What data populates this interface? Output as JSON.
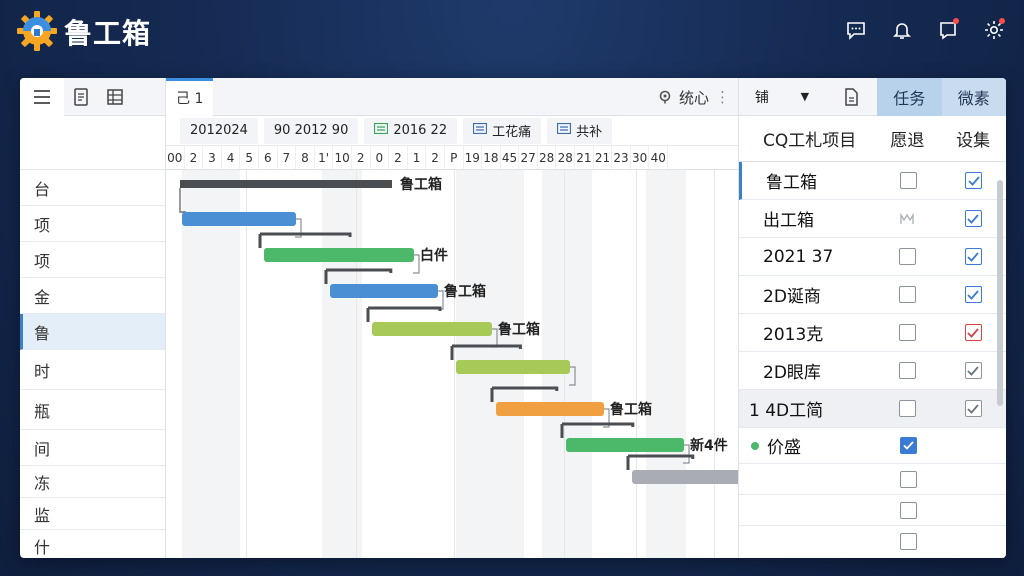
{
  "app": {
    "brand": "鲁工箱"
  },
  "left": {
    "rows": [
      {
        "label": "台",
        "size": ""
      },
      {
        "label": "项",
        "size": ""
      },
      {
        "label": "项",
        "size": ""
      },
      {
        "label": "金",
        "size": ""
      },
      {
        "label": "鲁",
        "size": "active"
      },
      {
        "label": "时",
        "size": "tall"
      },
      {
        "label": "瓶",
        "size": "tall"
      },
      {
        "label": "间",
        "size": ""
      },
      {
        "label": "冻",
        "size": "short"
      },
      {
        "label": "监",
        "size": "short"
      },
      {
        "label": "什",
        "size": "short"
      }
    ]
  },
  "gantt": {
    "tab_label": "己 1",
    "right_label": "统心",
    "periods": [
      {
        "label": "2012024",
        "icon": "none"
      },
      {
        "label": "90  2012 90",
        "icon": "none"
      },
      {
        "label": "2016 22",
        "icon": "green-list-icon"
      },
      {
        "label": "工花痛",
        "icon": "blue-list-icon"
      },
      {
        "label": "共补",
        "icon": "blue-list-icon"
      }
    ],
    "days": [
      "00",
      "2",
      "3",
      "4",
      "5",
      "6",
      "7",
      "8",
      "1'",
      "10",
      "2",
      "0",
      "2",
      "1",
      "2",
      "P",
      "19",
      "18",
      "45",
      "27",
      "28",
      "28",
      "21",
      "21",
      "23",
      "30",
      "40"
    ],
    "bar_labels": [
      "鲁工箱",
      "白件",
      "鲁工箱",
      "鲁工箱",
      "鲁工箱",
      "新4件"
    ]
  },
  "panel": {
    "select_label": "铺",
    "btn_tasks": "任务",
    "btn_search": "微素",
    "headers": {
      "name": "CQ工札项目",
      "col_a": "愿退",
      "col_b": "设集"
    },
    "rows": [
      {
        "name": "鲁工箱",
        "a": "empty",
        "b": "blue-check",
        "style": "hl"
      },
      {
        "name": "出工箱",
        "a": "partial",
        "b": "blue-check",
        "style": ""
      },
      {
        "name": "2021 37",
        "a": "empty",
        "b": "blue-check",
        "style": ""
      },
      {
        "name": "2D诞商",
        "a": "empty",
        "b": "blue-check",
        "style": ""
      },
      {
        "name": "2013克",
        "a": "empty",
        "b": "red-check",
        "style": ""
      },
      {
        "name": "2D眼库",
        "a": "empty",
        "b": "grey-check",
        "style": ""
      },
      {
        "name": "1 4D工简",
        "a": "empty",
        "b": "grey-check",
        "style": "grey"
      }
    ],
    "sub_row": {
      "name": "价盛",
      "a": "filled-check"
    }
  },
  "colors": {
    "accent": "#3b82c4",
    "bar_blue": "#4a8fd4",
    "bar_green": "#4cb86a",
    "bar_yellowgreen": "#a7c957",
    "bar_orange": "#f0a040",
    "bar_purple": "#b05bc0",
    "bar_grey": "#a9adb3"
  }
}
